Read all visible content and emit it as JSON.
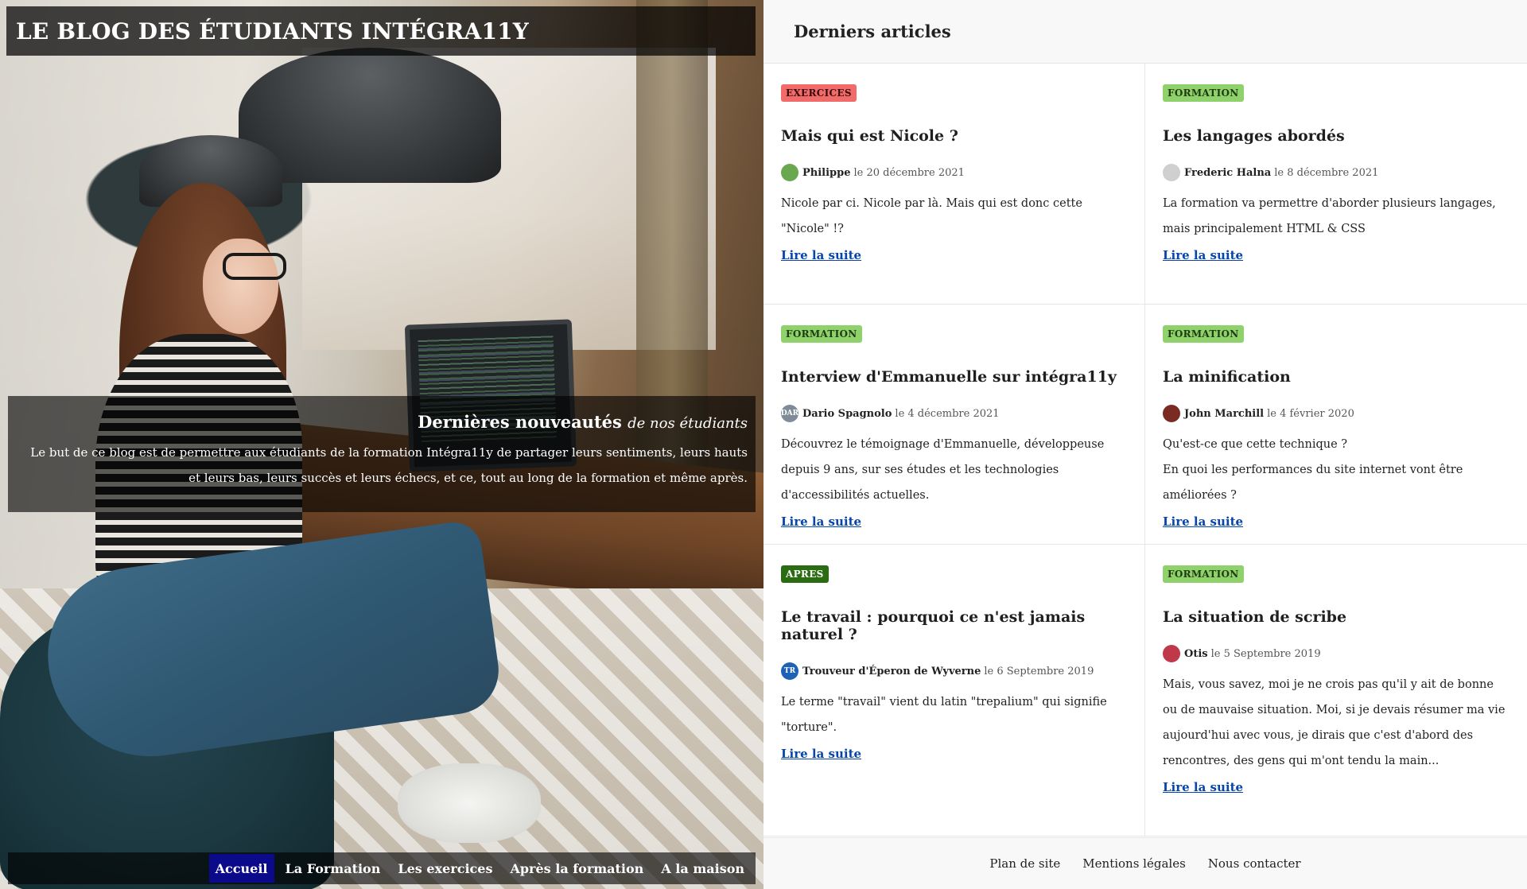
{
  "site": {
    "title": "LE BLOG DES ÉTUDIANTS INTÉGRA11Y"
  },
  "hero": {
    "heading": "Dernières nouveautés",
    "heading_sub": "de nos étudiants",
    "text": "Le but de ce blog est de permettre aux étudiants de la formation Intégra11y de partager leurs sentiments, leurs hauts et leurs bas, leurs succès et leurs échecs, et ce, tout au long de la formation et même après."
  },
  "nav": {
    "items": [
      {
        "label": "Accueil",
        "active": true
      },
      {
        "label": "La Formation",
        "active": false
      },
      {
        "label": "Les exercices",
        "active": false
      },
      {
        "label": "Après la formation",
        "active": false
      },
      {
        "label": "A la maison",
        "active": false
      }
    ]
  },
  "articles": {
    "heading": "Derniers articles",
    "items": [
      {
        "category": "EXERCICES",
        "category_bg": "#f26b6b",
        "category_fg": "#3a0a0a",
        "title": "Mais qui est Nicole ?",
        "author": "Philippe",
        "date": "le 20 décembre 2021",
        "avatar_color": "#6aa84f",
        "avatar_initials": "",
        "excerpt": "Nicole par ci. Nicole par là. Mais qui est donc cette \"Nicole\" !?",
        "read_more": "Lire la suite"
      },
      {
        "category": "FORMATION",
        "category_bg": "#8fd16a",
        "category_fg": "#1f3a10",
        "title": "Les langages abordés",
        "author": "Frederic Halna",
        "date": "le 8 décembre 2021",
        "avatar_color": "#cfcfcf",
        "avatar_initials": "",
        "excerpt": "La formation va permettre d'aborder plusieurs langages, mais principalement HTML & CSS",
        "read_more": "Lire la suite"
      },
      {
        "category": "FORMATION",
        "category_bg": "#8fd16a",
        "category_fg": "#1f3a10",
        "title": "Interview d'Emmanuelle sur intégra11y",
        "author": "Dario Spagnolo",
        "date": "le 4 décembre 2021",
        "avatar_color": "#7f8c97",
        "avatar_initials": "DAR",
        "excerpt": "Découvrez le témoignage d'Emmanuelle, développeuse depuis 9 ans, sur ses études et les technologies d'accessibilités actuelles.",
        "read_more": "Lire la suite"
      },
      {
        "category": "FORMATION",
        "category_bg": "#8fd16a",
        "category_fg": "#1f3a10",
        "title": "La minification",
        "author": "John Marchill",
        "date": "le 4 février 2020",
        "avatar_color": "#7a2b22",
        "avatar_initials": "",
        "excerpt": "Qu'est-ce que cette technique ?\nEn quoi les performances du site internet vont être améliorées ?",
        "read_more": "Lire la suite"
      },
      {
        "category": "APRES",
        "category_bg": "#2b6b12",
        "category_fg": "#ffffff",
        "title": "Le travail : pourquoi ce n'est jamais naturel ?",
        "author": "Trouveur d'Éperon de Wyverne",
        "date": "le 6 Septembre 2019",
        "avatar_color": "#1e62b6",
        "avatar_initials": "TR",
        "excerpt": "Le terme \"travail\" vient du latin \"trepalium\" qui signifie \"torture\".",
        "read_more": "Lire la suite"
      },
      {
        "category": "FORMATION",
        "category_bg": "#8fd16a",
        "category_fg": "#1f3a10",
        "title": "La situation de scribe",
        "author": "Otis",
        "date": "le 5 Septembre 2019",
        "avatar_color": "#c0394b",
        "avatar_initials": "",
        "excerpt": "Mais, vous savez, moi je ne crois pas qu'il y ait de bonne ou de mauvaise situation. Moi, si je devais résumer ma vie aujourd'hui avec vous, je dirais que c'est d'abord des rencontres, des gens qui m'ont tendu la main...",
        "read_more": "Lire la suite"
      }
    ]
  },
  "footer": {
    "links": [
      "Plan de site",
      "Mentions légales",
      "Nous contacter"
    ]
  }
}
